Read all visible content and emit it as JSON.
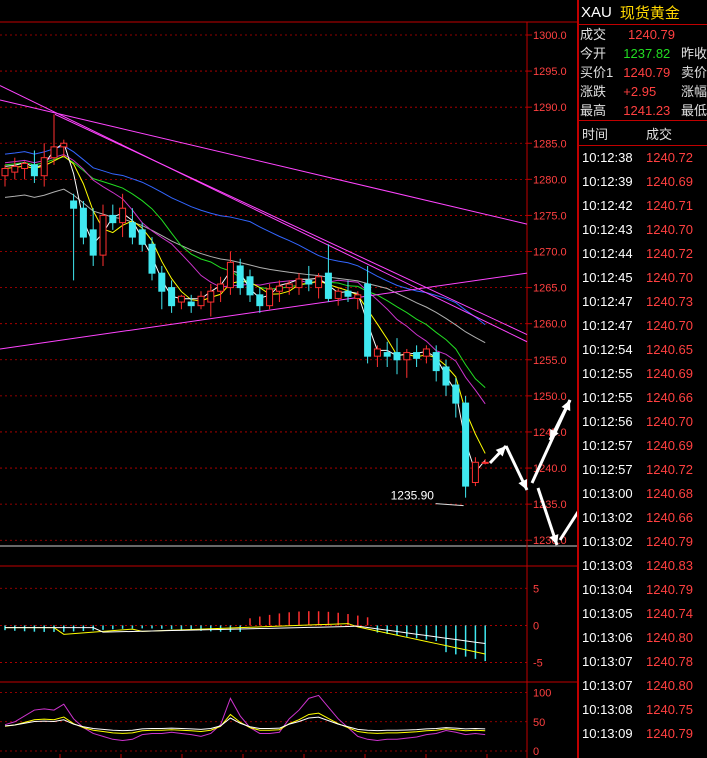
{
  "quote": {
    "symbol": "XAU",
    "name": "现货黄金",
    "rows": [
      {
        "label": "成交",
        "value": "1240.79",
        "color": "#ff4040",
        "label2": ""
      },
      {
        "label": "今开",
        "value": "1237.82",
        "color": "#22dd22",
        "label2": "昨收"
      },
      {
        "label": "买价1",
        "value": "1240.79",
        "color": "#ff4040",
        "label2": "卖价"
      },
      {
        "label": "涨跌",
        "value": "+2.95",
        "color": "#ff4040",
        "label2": "涨幅"
      },
      {
        "label": "最高",
        "value": "1241.23",
        "color": "#ff4040",
        "label2": "最低"
      }
    ]
  },
  "ticks": {
    "headers": {
      "time": "时间",
      "price": "成交"
    },
    "rows": [
      {
        "time": "10:12:38",
        "price": "1240.72"
      },
      {
        "time": "10:12:39",
        "price": "1240.69"
      },
      {
        "time": "10:12:42",
        "price": "1240.71"
      },
      {
        "time": "10:12:43",
        "price": "1240.70"
      },
      {
        "time": "10:12:44",
        "price": "1240.72"
      },
      {
        "time": "10:12:45",
        "price": "1240.70"
      },
      {
        "time": "10:12:47",
        "price": "1240.73"
      },
      {
        "time": "10:12:47",
        "price": "1240.70"
      },
      {
        "time": "10:12:54",
        "price": "1240.65"
      },
      {
        "time": "10:12:55",
        "price": "1240.69"
      },
      {
        "time": "10:12:55",
        "price": "1240.66"
      },
      {
        "time": "10:12:56",
        "price": "1240.70"
      },
      {
        "time": "10:12:57",
        "price": "1240.69"
      },
      {
        "time": "10:12:57",
        "price": "1240.72"
      },
      {
        "time": "10:13:00",
        "price": "1240.68"
      },
      {
        "time": "10:13:02",
        "price": "1240.66"
      },
      {
        "time": "10:13:02",
        "price": "1240.79"
      },
      {
        "time": "10:13:03",
        "price": "1240.83"
      },
      {
        "time": "10:13:04",
        "price": "1240.79"
      },
      {
        "time": "10:13:05",
        "price": "1240.74"
      },
      {
        "time": "10:13:06",
        "price": "1240.80"
      },
      {
        "time": "10:13:07",
        "price": "1240.78"
      },
      {
        "time": "10:13:07",
        "price": "1240.80"
      },
      {
        "time": "10:13:08",
        "price": "1240.75"
      },
      {
        "time": "10:13:09",
        "price": "1240.79"
      }
    ]
  },
  "main_chart": {
    "y_ticks": [
      "1300.0",
      "1295.0",
      "1290.0",
      "1285.0",
      "1280.0",
      "1275.0",
      "1270.0",
      "1265.0",
      "1260.0",
      "1255.0",
      "1250.0",
      "1245.0",
      "1240.0",
      "1235.0",
      "1230.0"
    ],
    "low_annotation": "1235.90",
    "candles": [
      {
        "o": 1280.5,
        "h": 1282,
        "l": 1279,
        "c": 1281.5
      },
      {
        "o": 1281,
        "h": 1283,
        "l": 1280,
        "c": 1281.8
      },
      {
        "o": 1281.5,
        "h": 1282.5,
        "l": 1280,
        "c": 1282.2
      },
      {
        "o": 1282,
        "h": 1284,
        "l": 1279.5,
        "c": 1280.5
      },
      {
        "o": 1280.5,
        "h": 1285,
        "l": 1279,
        "c": 1283
      },
      {
        "o": 1283,
        "h": 1289,
        "l": 1282,
        "c": 1284.5
      },
      {
        "o": 1284.5,
        "h": 1285.5,
        "l": 1283,
        "c": 1285
      },
      {
        "o": 1277,
        "h": 1278,
        "l": 1266,
        "c": 1276
      },
      {
        "o": 1276,
        "h": 1277,
        "l": 1271,
        "c": 1272
      },
      {
        "o": 1273,
        "h": 1276,
        "l": 1268,
        "c": 1269.5
      },
      {
        "o": 1269.5,
        "h": 1276.5,
        "l": 1268,
        "c": 1275
      },
      {
        "o": 1275,
        "h": 1276.5,
        "l": 1273,
        "c": 1274
      },
      {
        "o": 1274,
        "h": 1278,
        "l": 1272,
        "c": 1276
      },
      {
        "o": 1274,
        "h": 1276,
        "l": 1271,
        "c": 1272
      },
      {
        "o": 1273,
        "h": 1274,
        "l": 1270,
        "c": 1271
      },
      {
        "o": 1271,
        "h": 1272,
        "l": 1266,
        "c": 1267
      },
      {
        "o": 1267,
        "h": 1268,
        "l": 1262,
        "c": 1264.5
      },
      {
        "o": 1265,
        "h": 1266,
        "l": 1261.5,
        "c": 1262.5
      },
      {
        "o": 1263,
        "h": 1264,
        "l": 1262,
        "c": 1263.8
      },
      {
        "o": 1263,
        "h": 1264,
        "l": 1261.5,
        "c": 1262.5
      },
      {
        "o": 1262.5,
        "h": 1264.5,
        "l": 1262,
        "c": 1263.8
      },
      {
        "o": 1263,
        "h": 1265.5,
        "l": 1261,
        "c": 1264.5
      },
      {
        "o": 1264.5,
        "h": 1266.5,
        "l": 1263,
        "c": 1265.5
      },
      {
        "o": 1265,
        "h": 1270,
        "l": 1264,
        "c": 1268.5
      },
      {
        "o": 1268,
        "h": 1269,
        "l": 1264,
        "c": 1265
      },
      {
        "o": 1266.5,
        "h": 1267.5,
        "l": 1263,
        "c": 1264
      },
      {
        "o": 1264,
        "h": 1265,
        "l": 1261.5,
        "c": 1262.5
      },
      {
        "o": 1262.5,
        "h": 1265.5,
        "l": 1262,
        "c": 1264.8
      },
      {
        "o": 1264.5,
        "h": 1266,
        "l": 1263,
        "c": 1265.2
      },
      {
        "o": 1265,
        "h": 1266,
        "l": 1264,
        "c": 1265.5
      },
      {
        "o": 1265,
        "h": 1267,
        "l": 1264,
        "c": 1266.2
      },
      {
        "o": 1266,
        "h": 1268,
        "l": 1264.5,
        "c": 1265.5
      },
      {
        "o": 1265,
        "h": 1267,
        "l": 1263.5,
        "c": 1266.5
      },
      {
        "o": 1267,
        "h": 1271,
        "l": 1263,
        "c": 1263.5
      },
      {
        "o": 1263.5,
        "h": 1265,
        "l": 1262.5,
        "c": 1264.5
      },
      {
        "o": 1264.5,
        "h": 1266,
        "l": 1263,
        "c": 1263.8
      },
      {
        "o": 1263.5,
        "h": 1264.5,
        "l": 1262,
        "c": 1264
      },
      {
        "o": 1265.5,
        "h": 1268,
        "l": 1254.5,
        "c": 1255.5
      },
      {
        "o": 1255.5,
        "h": 1257,
        "l": 1254,
        "c": 1256.5
      },
      {
        "o": 1256,
        "h": 1257.5,
        "l": 1254,
        "c": 1255.5
      },
      {
        "o": 1256,
        "h": 1258,
        "l": 1253,
        "c": 1255
      },
      {
        "o": 1255,
        "h": 1256.5,
        "l": 1252.5,
        "c": 1256
      },
      {
        "o": 1256,
        "h": 1257,
        "l": 1254,
        "c": 1255.2
      },
      {
        "o": 1255.5,
        "h": 1257,
        "l": 1254.5,
        "c": 1256.5
      },
      {
        "o": 1256,
        "h": 1257,
        "l": 1252,
        "c": 1253.5
      },
      {
        "o": 1254,
        "h": 1255,
        "l": 1250,
        "c": 1251.5
      },
      {
        "o": 1251.5,
        "h": 1252.5,
        "l": 1247,
        "c": 1249
      },
      {
        "o": 1249,
        "h": 1250,
        "l": 1235.9,
        "c": 1237.5
      },
      {
        "o": 1238,
        "h": 1241.5,
        "l": 1237.5,
        "c": 1240.8
      },
      {
        "o": 1240.7,
        "h": 1241.23,
        "l": 1240.5,
        "c": 1240.79
      }
    ]
  },
  "indicator1": {
    "y_ticks": [
      "5",
      "0",
      "-5"
    ]
  },
  "indicator2": {
    "y_ticks": [
      "100",
      "50",
      "0"
    ]
  },
  "colors": {
    "up": "#ff3030",
    "down": "#40e8f0",
    "grid": "#c00000",
    "ma1": "#ffffff",
    "ma2": "#ffff00",
    "ma3": "#22dd22",
    "ma4": "#3366ff",
    "ma5": "#b0b0b0",
    "trend": "#ff44ff"
  }
}
